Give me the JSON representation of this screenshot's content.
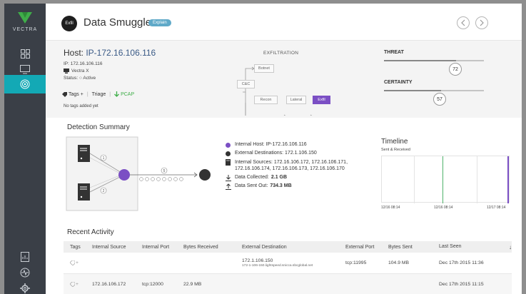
{
  "app": {
    "brand": "VECTRA",
    "brand_color": "#3fae49",
    "accent": "#13a9b5"
  },
  "header": {
    "badge": "Exfil",
    "title": "Data Smuggler",
    "explain_label": "Explain",
    "prev_icon": "chevron-left-icon",
    "next_icon": "chevron-right-icon"
  },
  "host": {
    "title_prefix": "Host: ",
    "title_value": "IP-172.16.106.116",
    "ip": "IP: 172.16.106.116",
    "sensor": "Vectra X",
    "status": "Status: ○ Active",
    "tags_label": "Tags +",
    "triage_label": "Triage",
    "pcap_label": "PCAP",
    "no_tags": "No tags added yet"
  },
  "flow": {
    "label": "EXFILTRATION",
    "nodes": {
      "cc": "C&C",
      "botnet": "Botnet",
      "recon": "Recon",
      "lateral": "Lateral",
      "exfil": "Exfil"
    },
    "exfil_color": "#7b4fc4"
  },
  "threat": {
    "label": "THREAT",
    "value": "72",
    "level": 72
  },
  "certainty": {
    "label": "CERTAINTY",
    "value": "57",
    "level": 57
  },
  "detection": {
    "title": "Detection Summary",
    "badge_1": "1",
    "badge_2": "2",
    "badge_5": "5",
    "legend": {
      "internal_host": "Internal Host: IP-172.16.106.116",
      "external_dest": "External Destinations: 172.1.106.150",
      "internal_sources": "Internal Sources: 172.16.106.172, 172.16.106.171, 172.16.106.174, 172.16.106.173, 172.16.106.170",
      "data_collected_label": "Data Collected:",
      "data_collected_value": "2.1 GB",
      "data_sent_label": "Data Sent Out:",
      "data_sent_value": "734.3 MB"
    }
  },
  "timeline": {
    "title": "Timeline",
    "subtitle": "Sent & Received",
    "labels": [
      "12/16 08:14",
      "12/16 08:14",
      "12/17 08:14"
    ]
  },
  "activity": {
    "title": "Recent Activity",
    "columns": [
      "Tags",
      "Internal Source",
      "Internal Port",
      "Bytes Received",
      "External Destination",
      "External Port",
      "Bytes Sent",
      "Last Seen"
    ],
    "rows": [
      {
        "tags": "+",
        "internal_source": "",
        "internal_port": "",
        "bytes_received": "",
        "ext_dest": "172.1.106.150",
        "ext_dest_host": "172-1-106-150.lightspeed.snicca.sbcglobal.net",
        "ext_port": "tcp:11995",
        "bytes_sent": "104.9 MB",
        "last_seen": "Dec 17th 2015 11:36"
      },
      {
        "tags": "+",
        "internal_source": "172.16.106.172",
        "internal_port": "tcp:12000",
        "bytes_received": "22.9 MB",
        "ext_dest": "",
        "ext_dest_host": "",
        "ext_port": "",
        "bytes_sent": "",
        "last_seen": "Dec 17th 2015 11:15"
      }
    ]
  }
}
